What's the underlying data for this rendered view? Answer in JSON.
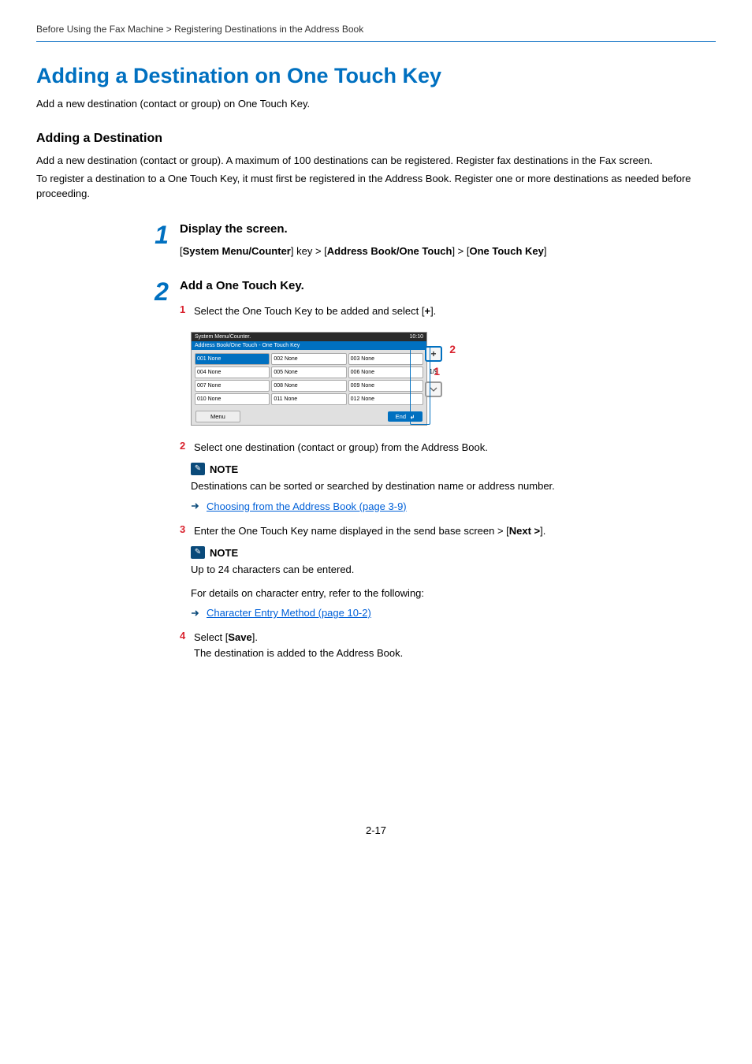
{
  "breadcrumb": "Before Using the Fax Machine > Registering Destinations in the Address Book",
  "h1": "Adding a Destination on One Touch Key",
  "intro": "Add a new destination (contact or group) on One Touch Key.",
  "addDest": {
    "heading": "Adding a Destination",
    "p1": "Add a new destination (contact or group). A maximum of 100 destinations can be registered. Register fax destinations in the Fax screen.",
    "p2": "To register a destination to a One Touch Key, it must first be registered in the Address Book. Register one or more destinations as needed before proceeding."
  },
  "step1": {
    "num": "1",
    "title": "Display the screen.",
    "path": {
      "pre": "[",
      "a": "System Menu/Counter",
      "mid1": "] key > [",
      "b": "Address Book/One Touch",
      "mid2": "] > [",
      "c": "One Touch Key",
      "post": "]"
    }
  },
  "step2": {
    "num": "2",
    "title": "Add a One Touch Key.",
    "sub1": {
      "num": "1",
      "text_a": "Select the One Touch Key to be added and select [",
      "plus": "+",
      "text_b": "]."
    },
    "shot": {
      "topLeft": "System Menu/Counter.",
      "topRight": "10:10",
      "bar": "Address Book/One Touch - One Touch Key",
      "cells": [
        "001 None",
        "002 None",
        "003 None",
        "004 None",
        "005 None",
        "006 None",
        "007 None",
        "008 None",
        "009 None",
        "010 None",
        "011 None",
        "012 None"
      ],
      "menu": "Menu",
      "end": "End",
      "plus": "+",
      "pager": "1/9",
      "callout1": "1",
      "callout2": "2"
    },
    "sub2": {
      "num": "2",
      "text": "Select one destination (contact or group) from the Address Book."
    },
    "note1": {
      "label": "NOTE",
      "text": "Destinations can be sorted or searched by destination name or address number.",
      "link": "Choosing from the Address Book (page 3-9)"
    },
    "sub3": {
      "num": "3",
      "text_a": "Enter the One Touch Key name displayed in the send base screen > [",
      "next": "Next >",
      "text_b": "]."
    },
    "note2": {
      "label": "NOTE",
      "line1": "Up to 24 characters can be entered.",
      "line2": "For details on character entry, refer to the following:",
      "link": "Character Entry Method (page 10-2)"
    },
    "sub4": {
      "num": "4",
      "text_a": "Select [",
      "save": "Save",
      "text_b": "].",
      "text_c": "The destination is added to the Address Book."
    }
  },
  "footer": "2-17"
}
